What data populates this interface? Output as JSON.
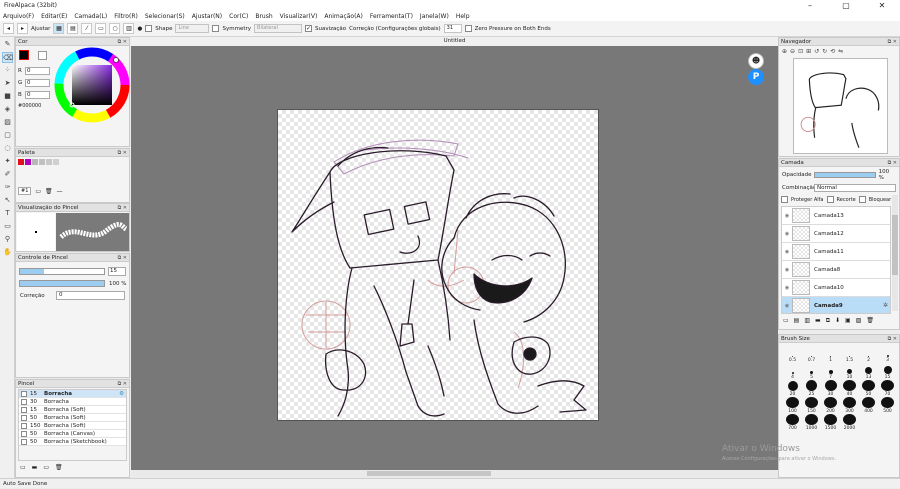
{
  "app": {
    "title": "FireAlpaca (32bit)",
    "doc_title": "Untitled"
  },
  "menu": [
    "Arquivo(F)",
    "Editar(E)",
    "Camada(L)",
    "Filtro(R)",
    "Selecionar(S)",
    "Ajustar(N)",
    "Cor(C)",
    "Brush",
    "Visualizar(V)",
    "Animação(A)",
    "Ferramenta(T)",
    "Janela(W)",
    "Help"
  ],
  "toolbar": {
    "ajustar": "Ajustar",
    "shape": "Shape",
    "shape_val": "Line",
    "symmetry": "Symmetry",
    "symmetry_val": "Bilateral",
    "suavizacao": "Suavização",
    "correcao": "Correção (Configurações globais)",
    "correcao_val": "31",
    "zero_pressure": "Zero Pressure on Both Ends"
  },
  "cor": {
    "title": "Cor",
    "r": "0",
    "g": "0",
    "b": "0",
    "r_label": "R",
    "g_label": "G",
    "b_label": "B",
    "hex": "#000000"
  },
  "paleta": {
    "title": "Paleta",
    "index": "#1",
    "colors": [
      "#e01020",
      "#b000c0",
      "#b8b8b8",
      "#c0c0c0",
      "#c8c8c8",
      "#d0d0d0"
    ]
  },
  "viz_pincel": {
    "title": "Visualização do Pincel"
  },
  "controle": {
    "title": "Controle de Pincel",
    "size": "15",
    "opacity": "100 %",
    "correcao_label": "Correção",
    "correcao_val": "0"
  },
  "pincel": {
    "title": "Pincel",
    "items": [
      {
        "size": "15",
        "name": "Borracha"
      },
      {
        "size": "30",
        "name": "Borracha"
      },
      {
        "size": "15",
        "name": "Borracha (Soft)"
      },
      {
        "size": "50",
        "name": "Borracha (Soft)"
      },
      {
        "size": "150",
        "name": "Borracha (Soft)"
      },
      {
        "size": "50",
        "name": "Borracha (Canvas)"
      },
      {
        "size": "50",
        "name": "Borracha (Sketchbook)"
      }
    ]
  },
  "navegador": {
    "title": "Navegador"
  },
  "camada": {
    "title": "Camada",
    "opacidade_label": "Opacidade",
    "opacidade_val": "100 %",
    "combinacao_label": "Combinação",
    "combinacao_val": "Normal",
    "proteger": "Proteger Alfa",
    "recorte": "Recorte",
    "bloquear": "Bloquear",
    "layers": [
      "Camada13",
      "Camada12",
      "Camada11",
      "Camada8",
      "Camada10",
      "Camada9"
    ]
  },
  "brush_size": {
    "title": "Brush Size",
    "sizes": [
      "0.5",
      "0.7",
      "1",
      "1.5",
      "2",
      "3",
      "4",
      "5",
      "7",
      "10",
      "13",
      "15",
      "20",
      "25",
      "30",
      "40",
      "50",
      "70",
      "100",
      "150",
      "200",
      "300",
      "400",
      "500",
      "700",
      "1000",
      "1500",
      "2000"
    ]
  },
  "status": "Auto Save Done",
  "watermark": {
    "line1": "Ativar o Windows",
    "line2": "Acesse Configurações para ativar o Windows."
  }
}
